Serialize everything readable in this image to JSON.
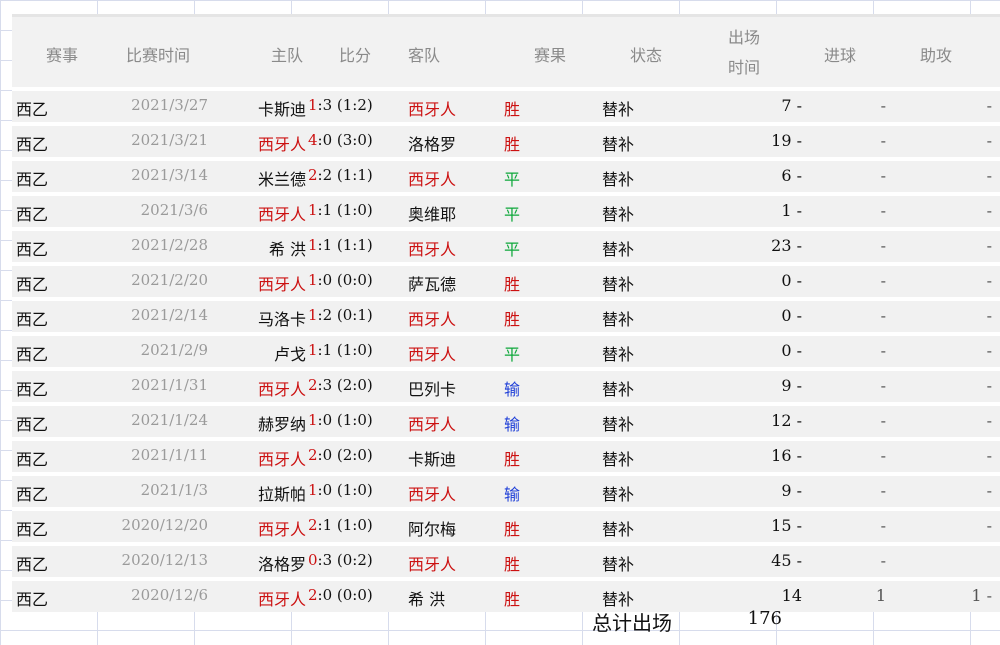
{
  "headers": {
    "league": "赛事",
    "date": "比赛时间",
    "home": "主队",
    "score": "比分",
    "away": "客队",
    "result": "赛果",
    "status": "状态",
    "duration_line1": "出场",
    "duration_line2": "时间",
    "goals": "进球",
    "assists": "助攻"
  },
  "rows": [
    {
      "league": "西乙",
      "date": "2021/3/27",
      "home": "卡斯迪",
      "score_home": "1",
      "score_rest": ":3 (1:2)",
      "away": "西牙人",
      "result": "胜",
      "status": "替补",
      "minutes": "7 -",
      "goals": "-",
      "assists": "-"
    },
    {
      "league": "西乙",
      "date": "2021/3/21",
      "home": "西牙人",
      "score_home": "4",
      "score_rest": ":0 (3:0)",
      "away": "洛格罗",
      "result": "胜",
      "status": "替补",
      "minutes": "19 -",
      "goals": "-",
      "assists": "-"
    },
    {
      "league": "西乙",
      "date": "2021/3/14",
      "home": "米兰德",
      "score_home": "2",
      "score_rest": ":2 (1:1)",
      "away": "西牙人",
      "result": "平",
      "status": "替补",
      "minutes": "6 -",
      "goals": "-",
      "assists": "-"
    },
    {
      "league": "西乙",
      "date": "2021/3/6",
      "home": "西牙人",
      "score_home": "1",
      "score_rest": ":1 (1:0)",
      "away": "奥维耶",
      "result": "平",
      "status": "替补",
      "minutes": "1 -",
      "goals": "-",
      "assists": "-"
    },
    {
      "league": "西乙",
      "date": "2021/2/28",
      "home": "希 洪",
      "score_home": "1",
      "score_rest": ":1 (1:1)",
      "away": "西牙人",
      "result": "平",
      "status": "替补",
      "minutes": "23 -",
      "goals": "-",
      "assists": "-"
    },
    {
      "league": "西乙",
      "date": "2021/2/20",
      "home": "西牙人",
      "score_home": "1",
      "score_rest": ":0 (0:0)",
      "away": "萨瓦德",
      "result": "胜",
      "status": "替补",
      "minutes": "0 -",
      "goals": "-",
      "assists": "-"
    },
    {
      "league": "西乙",
      "date": "2021/2/14",
      "home": "马洛卡",
      "score_home": "1",
      "score_rest": ":2 (0:1)",
      "away": "西牙人",
      "result": "胜",
      "status": "替补",
      "minutes": "0 -",
      "goals": "-",
      "assists": "-"
    },
    {
      "league": "西乙",
      "date": "2021/2/9",
      "home": "卢戈",
      "score_home": "1",
      "score_rest": ":1 (1:0)",
      "away": "西牙人",
      "result": "平",
      "status": "替补",
      "minutes": "0 -",
      "goals": "-",
      "assists": "-"
    },
    {
      "league": "西乙",
      "date": "2021/1/31",
      "home": "西牙人",
      "score_home": "2",
      "score_rest": ":3 (2:0)",
      "away": "巴列卡",
      "result": "输",
      "status": "替补",
      "minutes": "9 -",
      "goals": "-",
      "assists": "-"
    },
    {
      "league": "西乙",
      "date": "2021/1/24",
      "home": "赫罗纳",
      "score_home": "1",
      "score_rest": ":0 (1:0)",
      "away": "西牙人",
      "result": "输",
      "status": "替补",
      "minutes": "12 -",
      "goals": "-",
      "assists": "-"
    },
    {
      "league": "西乙",
      "date": "2021/1/11",
      "home": "西牙人",
      "score_home": "2",
      "score_rest": ":0 (2:0)",
      "away": "卡斯迪",
      "result": "胜",
      "status": "替补",
      "minutes": "16 -",
      "goals": "-",
      "assists": "-"
    },
    {
      "league": "西乙",
      "date": "2021/1/3",
      "home": "拉斯帕",
      "score_home": "1",
      "score_rest": ":0 (1:0)",
      "away": "西牙人",
      "result": "输",
      "status": "替补",
      "minutes": "9 -",
      "goals": "-",
      "assists": "-"
    },
    {
      "league": "西乙",
      "date": "2020/12/20",
      "home": "西牙人",
      "score_home": "2",
      "score_rest": ":1 (1:0)",
      "away": "阿尔梅",
      "result": "胜",
      "status": "替补",
      "minutes": "15 -",
      "goals": "-",
      "assists": "-"
    },
    {
      "league": "西乙",
      "date": "2020/12/13",
      "home": "洛格罗",
      "score_home": "0",
      "score_rest": ":3 (0:2)",
      "away": "西牙人",
      "result": "胜",
      "status": "替补",
      "minutes": "45 -",
      "goals": "-",
      "assists": ""
    },
    {
      "league": "西乙",
      "date": "2020/12/6",
      "home": "西牙人",
      "score_home": "2",
      "score_rest": ":0 (0:0)",
      "away": "希 洪",
      "result": "胜",
      "status": "替补",
      "minutes": "14",
      "goals": "1",
      "assists": "1 -"
    }
  ],
  "total": {
    "label": "总计出场",
    "value": "176"
  },
  "colors": {
    "highlight_team": "#cc1111",
    "win": "#cc1111",
    "draw": "#0fa83c",
    "loss": "#1f3fd8"
  }
}
